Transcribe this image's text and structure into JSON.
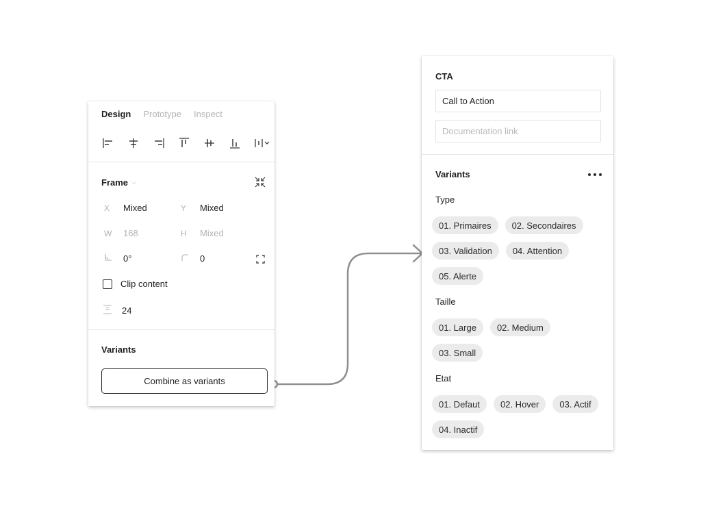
{
  "left_panel": {
    "tabs": [
      {
        "label": "Design"
      },
      {
        "label": "Prototype"
      },
      {
        "label": "Inspect"
      }
    ],
    "align_icons": [
      "align-left-icon",
      "align-horizontal-center-icon",
      "align-right-icon",
      "align-top-icon",
      "align-vertical-center-icon",
      "align-bottom-icon",
      "distribute-icon"
    ],
    "frame": {
      "title": "Frame",
      "x_label": "X",
      "x_value": "Mixed",
      "y_label": "Y",
      "y_value": "Mixed",
      "w_label": "W",
      "w_value": "168",
      "h_label": "H",
      "h_value": "Mixed",
      "rotation_value": "0°",
      "radius_value": "0",
      "clip_label": "Clip content",
      "spacing_value": "24"
    },
    "variants": {
      "title": "Variants",
      "button_label": "Combine as variants"
    }
  },
  "right_panel": {
    "title": "CTA",
    "description_value": "Call to Action",
    "doc_placeholder": "Documentation link",
    "variants_title": "Variants",
    "groups": [
      {
        "label": "Type",
        "rows": [
          [
            "01. Primaires",
            "02. Secondaires"
          ],
          [
            "03. Validation",
            "04. Attention"
          ],
          [
            "05. Alerte"
          ]
        ]
      },
      {
        "label": "Taille",
        "rows": [
          [
            "01. Large",
            "02. Medium"
          ],
          [
            "03. Small"
          ]
        ]
      },
      {
        "label": "Etat",
        "rows": [
          [
            "01. Defaut",
            "02. Hover",
            "03. Actif"
          ],
          [
            "04. Inactif"
          ]
        ]
      }
    ]
  },
  "colors": {
    "connector": "#8f8f8f",
    "chip_bg": "#ebebeb"
  }
}
